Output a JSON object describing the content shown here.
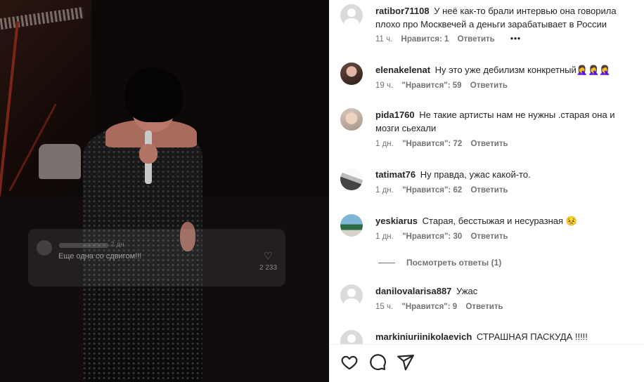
{
  "media": {
    "overlay": {
      "time": "2 дн.",
      "text": "Еще одна со сдвигом!!!",
      "likes": "2 233"
    }
  },
  "comments": [
    {
      "user": "ratibor71108",
      "text": "У неё как-то брали интервью она говорила плохо про Москвечей а деньги зарабатывает в России",
      "time": "11 ч.",
      "likes": "Нравится: 1",
      "reply": "Ответить",
      "more": "•••",
      "avatar": "default-avatar"
    },
    {
      "user": "elenakelenat",
      "text": "Ну это уже дебилизм конкретный",
      "emoji": "🤦‍♀️🤦‍♀️🤦‍♀️",
      "time": "19 ч.",
      "likes": "\"Нравится\": 59",
      "reply": "Ответить",
      "avatar": "photo-avatar"
    },
    {
      "user": "pida1760",
      "text": "Не такие артисты нам не нужны .старая она и мозги сьехали",
      "time": "1 дн.",
      "likes": "\"Нравится\": 72",
      "reply": "Ответить",
      "avatar": "photo-avatar"
    },
    {
      "user": "tatimat76",
      "text": "Ну правда, ужас какой-то.",
      "time": "1 дн.",
      "likes": "\"Нравится\": 62",
      "reply": "Ответить",
      "avatar": "photo-avatar"
    },
    {
      "user": "yeskiarus",
      "text": "Старая, бесстыжая и несуразная",
      "emoji": "😣",
      "time": "1 дн.",
      "likes": "\"Нравится\": 30",
      "reply": "Ответить",
      "avatar": "photo-avatar"
    },
    {
      "user": "danilovalarisa887",
      "text": "Ужас",
      "time": "15 ч.",
      "likes": "\"Нравится\": 9",
      "reply": "Ответить",
      "avatar": "default-avatar"
    },
    {
      "user": "markiniuriinikolaevich",
      "text": "СТРАШНАЯ ПАСКУДА !!!!!",
      "avatar": "default-avatar"
    }
  ],
  "view_replies": "Посмотреть ответы (1)",
  "actions": {
    "like": "heart-icon",
    "comment": "comment-icon",
    "share": "share-icon"
  }
}
